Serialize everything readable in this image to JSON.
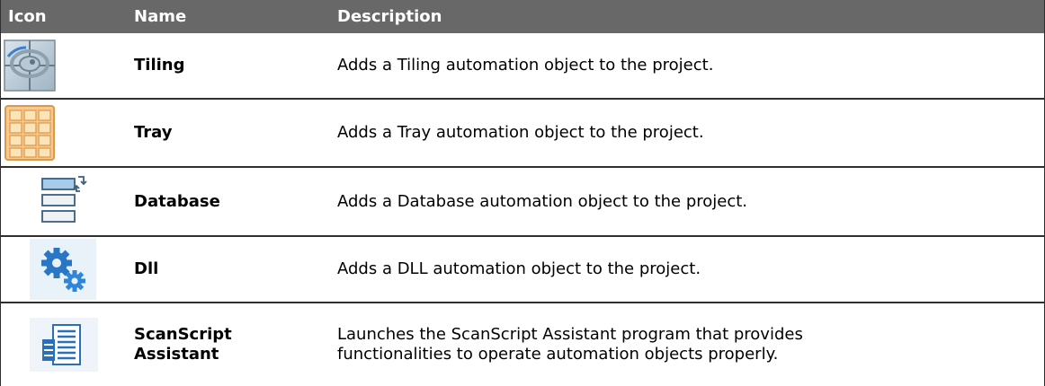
{
  "header": {
    "icon": "Icon",
    "name": "Name",
    "description": "Description"
  },
  "rows": [
    {
      "icon": "tiling-icon",
      "name": "Tiling",
      "description": "Adds a Tiling automation object to the project."
    },
    {
      "icon": "tray-icon",
      "name": "Tray",
      "description": "Adds a Tray automation object to the project."
    },
    {
      "icon": "database-icon",
      "name": "Database",
      "description": "Adds a Database automation object to the project."
    },
    {
      "icon": "dll-gears-icon",
      "name": "Dll",
      "description": "Adds a DLL automation object to the project."
    },
    {
      "icon": "scanscript-assistant-icon",
      "name_line1": "ScanScript",
      "name_line2": "Assistant",
      "description_line1": "Launches the ScanScript Assistant program that provides",
      "description_line2": "functionalities to operate automation objects properly."
    }
  ],
  "colors": {
    "header_bg": "#686868",
    "header_text": "#ffffff",
    "rule": "#2f2f2f"
  }
}
